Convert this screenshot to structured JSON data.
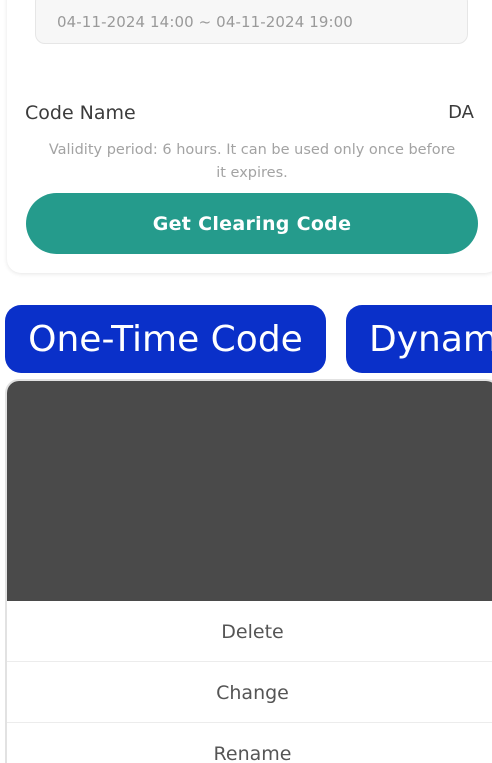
{
  "card": {
    "time_range": "04-11-2024 14:00 ~ 04-11-2024 19:00",
    "code_name_label": "Code Name",
    "code_name_value": "DA",
    "validity_text": "Validity period: 6 hours. It can be used only once before it expires.",
    "get_code_button": "Get Clearing Code",
    "button_color": "#259b8c"
  },
  "tabs": {
    "one_time": "One-Time Code",
    "dynamic": "Dynam",
    "pill_color": "#0a30c9"
  },
  "sheet": {
    "items": [
      {
        "label": "Delete"
      },
      {
        "label": "Change"
      },
      {
        "label": "Rename"
      }
    ]
  }
}
